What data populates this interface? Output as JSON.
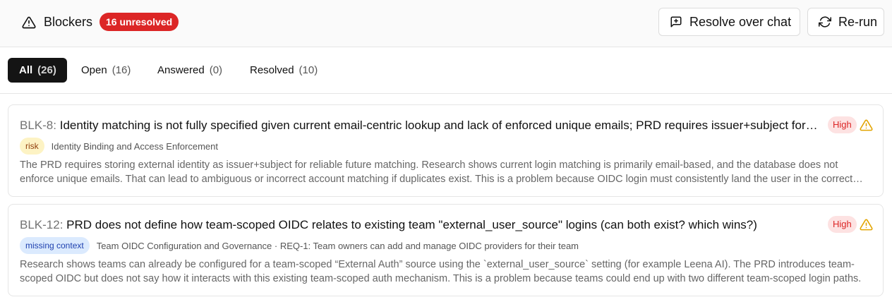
{
  "header": {
    "title": "Blockers",
    "badge": "16 unresolved",
    "resolve_chat_label": "Resolve over chat",
    "rerun_label": "Re-run"
  },
  "tabs": [
    {
      "label": "All",
      "count": "(26)"
    },
    {
      "label": "Open",
      "count": "(16)"
    },
    {
      "label": "Answered",
      "count": "(0)"
    },
    {
      "label": "Resolved",
      "count": "(10)"
    }
  ],
  "blockers": [
    {
      "id": "BLK-8:",
      "title": "Identity matching is not fully specified given current email-centric lookup and lack of enforced unique emails; PRD requires issuer+subject for reliable matching",
      "severity": "High",
      "tag": "risk",
      "meta": "Identity Binding and Access Enforcement",
      "description": "The PRD requires storing external identity as issuer+subject for reliable future matching. Research shows current login matching is primarily email-based, and the database does not enforce unique emails. That can lead to ambiguous or incorrect account matching if duplicates exist. This is a problem because OIDC login must consistently land the user in the correct account."
    },
    {
      "id": "BLK-12:",
      "title": "PRD does not define how team-scoped OIDC relates to existing team \"external_user_source\" logins (can both exist? which wins?)",
      "severity": "High",
      "tag": "missing context",
      "meta": "Team OIDC Configuration and Governance · REQ-1: Team owners can add and manage OIDC providers for their team",
      "description": "Research shows teams can already be configured for a team-scoped “External Auth” source using the `external_user_source` setting (for example Leena AI). The PRD introduces team-scoped OIDC but does not say how it interacts with this existing team-scoped auth mechanism. This is a problem because teams could end up with two different team-scoped login paths."
    }
  ],
  "colors": {
    "badge_red": "#dc2626",
    "active_tab": "#141414",
    "risk_tag": "#fdf3c4",
    "missing_tag": "#dbeafe",
    "warning_yellow": "#e2a400"
  }
}
